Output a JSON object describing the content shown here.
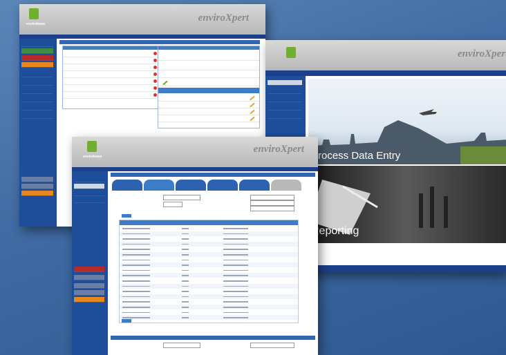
{
  "brand": "enviroXpert",
  "logo_text": "envirolease",
  "colors": {
    "background": "#4473ab",
    "nav": "#1c3f8a",
    "sidebar": "#1e4d9a",
    "accent_orange": "#e8871e",
    "logo_green": "#6fb02c"
  },
  "win_back": {
    "nav_title": "",
    "sidebar": [
      "",
      "",
      "",
      "",
      "",
      "",
      "",
      "",
      "",
      "",
      ""
    ],
    "list_rows": [
      "",
      "",
      "",
      "",
      "",
      "",
      "",
      ""
    ],
    "detail_rows": [
      "",
      "",
      "",
      "",
      ""
    ]
  },
  "win_right": {
    "banner1": "Process Data Entry",
    "banner2": "Reporting"
  },
  "win_front": {
    "tabs": [
      "",
      "",
      "",
      "",
      "",
      ""
    ],
    "table_rows": 18
  }
}
